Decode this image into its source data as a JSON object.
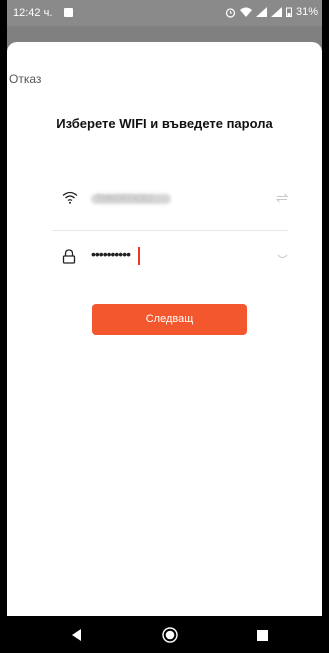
{
  "status_bar": {
    "time": "12:42 ч.",
    "battery": "31%"
  },
  "dialog": {
    "cancel_label": "Отказ",
    "title": "Изберете WIFI и въведете парола",
    "wifi": {
      "ssid_blurred": "TMKOFFICE1",
      "icon": "wifi-icon",
      "action_icon": "switch-arrows-icon"
    },
    "password": {
      "masked_value": "••••••••••",
      "icon": "lock-icon",
      "action_icon": "eye-closed-icon"
    },
    "next_button_label": "Следващ",
    "accent_color": "#f2572d"
  },
  "nav_bar": {
    "icons": [
      "back-icon",
      "home-icon",
      "recents-icon"
    ]
  }
}
